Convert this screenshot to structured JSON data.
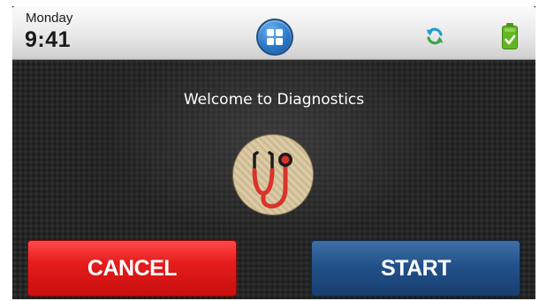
{
  "status_bar": {
    "day": "Monday",
    "time": "9:41",
    "home_icon": "grid-home-icon",
    "sync_icon": "sync-icon",
    "battery_icon": "battery-check-icon"
  },
  "main": {
    "welcome_text": "Welcome to Diagnostics",
    "hero_icon": "stethoscope-icon"
  },
  "actions": {
    "cancel_label": "CANCEL",
    "start_label": "START"
  },
  "colors": {
    "cancel": "#e51c1c",
    "start": "#22518a",
    "home_button": "#2a78c9",
    "sync": "#1f9bd6",
    "battery": "#5cb31f",
    "stethoscope_tube": "#d9342b"
  }
}
